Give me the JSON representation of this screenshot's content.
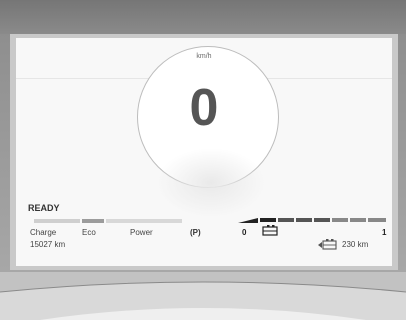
{
  "speed": {
    "unit": "km/h",
    "value": "0"
  },
  "status": {
    "ready": "READY"
  },
  "power_meter": {
    "labels": {
      "charge": "Charge",
      "eco": "Eco",
      "power": "Power"
    }
  },
  "gear": {
    "park_symbol": "(P)"
  },
  "indicators": {
    "left_value": "0",
    "right_value": "1"
  },
  "odometer": "15027 km",
  "range": "230 km"
}
